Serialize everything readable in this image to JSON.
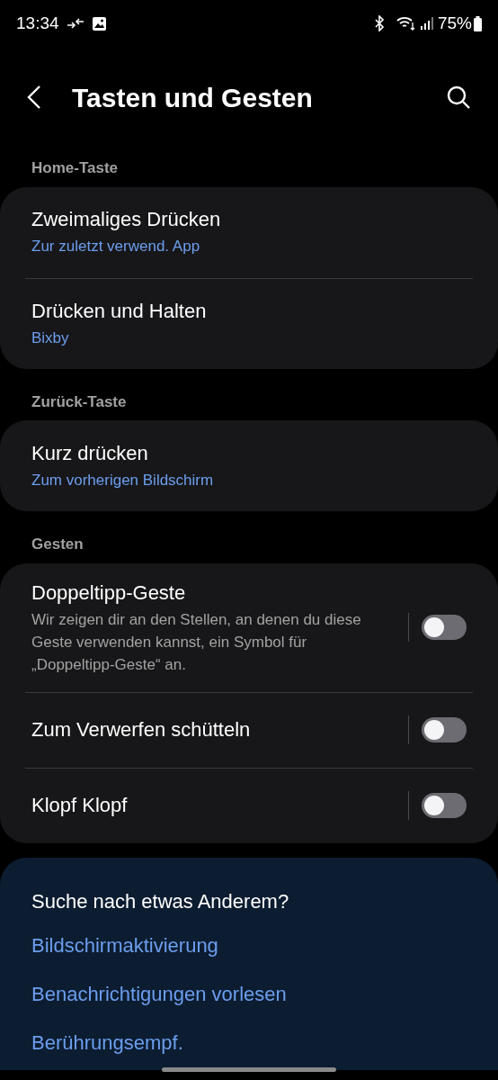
{
  "status_bar": {
    "time": "13:34",
    "battery": "75%"
  },
  "header": {
    "title": "Tasten und Gesten"
  },
  "sections": [
    {
      "title": "Home-Taste",
      "items": [
        {
          "kind": "link",
          "title": "Zweimaliges Drücken",
          "value": "Zur zuletzt verwend. App"
        },
        {
          "kind": "link",
          "title": "Drücken und Halten",
          "value": "Bixby"
        }
      ]
    },
    {
      "title": "Zurück-Taste",
      "items": [
        {
          "kind": "link",
          "title": "Kurz drücken",
          "value": "Zum vorherigen Bildschirm"
        }
      ]
    },
    {
      "title": "Gesten",
      "items": [
        {
          "kind": "toggle",
          "title": "Doppeltipp-Geste",
          "description": "Wir zeigen dir an den Stellen, an denen du diese Geste verwenden kannst, ein Symbol für „Doppeltipp-Geste“ an.",
          "on": false
        },
        {
          "kind": "toggle",
          "title": "Zum Verwerfen schütteln",
          "on": false
        },
        {
          "kind": "toggle",
          "title": "Klopf Klopf",
          "on": false
        }
      ]
    }
  ],
  "suggestions": {
    "title": "Suche nach etwas Anderem?",
    "links": [
      "Bildschirmaktivierung",
      "Benachrichtigungen vorlesen",
      "Berührungsempf."
    ]
  }
}
